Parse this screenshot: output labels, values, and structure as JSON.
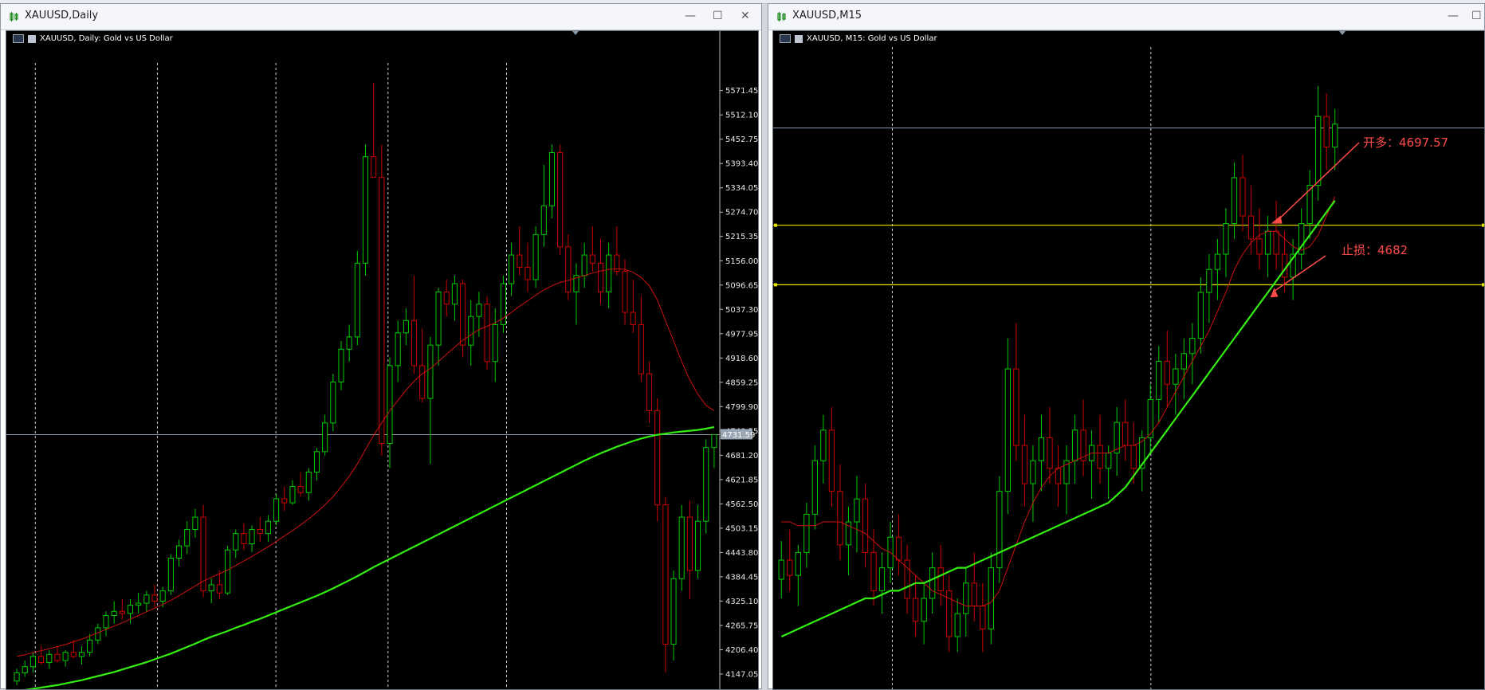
{
  "windows": [
    {
      "title": "XAUUSD,Daily",
      "chart_label": "XAUUSD, Daily:  Gold vs US Dollar"
    },
    {
      "title": "XAUUSD,M15",
      "chart_label": "XAUUSD, M15:  Gold vs US Dollar"
    }
  ],
  "window_controls": {
    "minimize": "—",
    "maximize": "☐",
    "close": "✕"
  },
  "colors": {
    "background": "#000000",
    "bull": "#00cc00",
    "bear": "#cc0000",
    "ma_fast": "#cc1111",
    "ma_slow": "#33ee11",
    "level": "#e6e600",
    "annotation": "#ff4a4a"
  },
  "annotations": {
    "entry_text": "开多：4697.57",
    "stop_text": "止损：4682"
  },
  "chart_data": [
    {
      "type": "candlestick",
      "title": "XAUUSD, Daily:  Gold vs US Dollar",
      "y_ticks": [
        "5571.45",
        "5512.10",
        "5452.75",
        "5393.40",
        "5334.05",
        "5274.70",
        "5215.35",
        "5156.00",
        "5096.65",
        "5037.30",
        "4977.95",
        "4918.60",
        "4859.25",
        "4799.90",
        "4740.55",
        "4681.20",
        "4621.85",
        "4562.50",
        "4503.15",
        "4443.80",
        "4384.45",
        "4325.10",
        "4265.75",
        "4206.40",
        "4147.05"
      ],
      "ylim": [
        4110,
        5600
      ],
      "current_price_label": "4731.59",
      "current_price": 4731.59,
      "grid": "vertical dashed separators",
      "ohlc": [
        [
          4130,
          4160,
          4120,
          4150
        ],
        [
          4150,
          4180,
          4140,
          4165
        ],
        [
          4165,
          4200,
          4150,
          4190
        ],
        [
          4190,
          4215,
          4170,
          4175
        ],
        [
          4175,
          4205,
          4160,
          4195
        ],
        [
          4195,
          4215,
          4175,
          4180
        ],
        [
          4180,
          4205,
          4165,
          4200
        ],
        [
          4200,
          4230,
          4185,
          4190
        ],
        [
          4190,
          4215,
          4170,
          4200
        ],
        [
          4200,
          4245,
          4190,
          4230
        ],
        [
          4230,
          4270,
          4220,
          4260
        ],
        [
          4260,
          4300,
          4240,
          4290
        ],
        [
          4290,
          4325,
          4270,
          4300
        ],
        [
          4300,
          4330,
          4280,
          4295
        ],
        [
          4295,
          4330,
          4270,
          4315
        ],
        [
          4315,
          4345,
          4295,
          4320
        ],
        [
          4320,
          4350,
          4300,
          4340
        ],
        [
          4340,
          4365,
          4310,
          4325
        ],
        [
          4325,
          4360,
          4310,
          4350
        ],
        [
          4350,
          4440,
          4340,
          4430
        ],
        [
          4430,
          4475,
          4410,
          4460
        ],
        [
          4460,
          4520,
          4440,
          4500
        ],
        [
          4500,
          4550,
          4480,
          4530
        ],
        [
          4530,
          4560,
          4335,
          4350
        ],
        [
          4350,
          4380,
          4320,
          4365
        ],
        [
          4365,
          4400,
          4330,
          4345
        ],
        [
          4345,
          4460,
          4340,
          4450
        ],
        [
          4450,
          4500,
          4430,
          4490
        ],
        [
          4490,
          4515,
          4450,
          4465
        ],
        [
          4465,
          4510,
          4445,
          4500
        ],
        [
          4500,
          4530,
          4470,
          4490
        ],
        [
          4490,
          4535,
          4470,
          4520
        ],
        [
          4520,
          4585,
          4510,
          4575
        ],
        [
          4575,
          4605,
          4545,
          4565
        ],
        [
          4565,
          4620,
          4560,
          4605
        ],
        [
          4605,
          4640,
          4580,
          4590
        ],
        [
          4590,
          4650,
          4570,
          4640
        ],
        [
          4640,
          4700,
          4620,
          4690
        ],
        [
          4690,
          4780,
          4680,
          4760
        ],
        [
          4760,
          4880,
          4740,
          4860
        ],
        [
          4860,
          4960,
          4840,
          4940
        ],
        [
          4940,
          5000,
          4910,
          4970
        ],
        [
          4970,
          5180,
          4950,
          5150
        ],
        [
          5150,
          5440,
          5120,
          5410
        ],
        [
          5410,
          5590,
          5360,
          5360
        ],
        [
          5360,
          5440,
          4680,
          4710
        ],
        [
          4710,
          4920,
          4650,
          4900
        ],
        [
          4900,
          5010,
          4860,
          4980
        ],
        [
          4980,
          5040,
          4950,
          5010
        ],
        [
          5010,
          5120,
          4880,
          4900
        ],
        [
          4900,
          4990,
          4810,
          4820
        ],
        [
          4820,
          4970,
          4660,
          4950
        ],
        [
          4950,
          5090,
          4900,
          5080
        ],
        [
          5080,
          5110,
          5020,
          5050
        ],
        [
          5050,
          5120,
          5010,
          5100
        ],
        [
          5100,
          5110,
          4920,
          4950
        ],
        [
          4950,
          5060,
          4900,
          5020
        ],
        [
          5020,
          5080,
          4970,
          5050
        ],
        [
          5050,
          5070,
          4890,
          4910
        ],
        [
          4910,
          5040,
          4860,
          5000
        ],
        [
          5000,
          5120,
          4980,
          5100
        ],
        [
          5100,
          5200,
          5070,
          5170
        ],
        [
          5170,
          5240,
          5120,
          5140
        ],
        [
          5140,
          5200,
          5080,
          5110
        ],
        [
          5110,
          5240,
          5090,
          5220
        ],
        [
          5220,
          5390,
          5190,
          5290
        ],
        [
          5290,
          5440,
          5260,
          5420
        ],
        [
          5420,
          5440,
          5170,
          5190
        ],
        [
          5190,
          5220,
          5060,
          5080
        ],
        [
          5080,
          5150,
          5000,
          5120
        ],
        [
          5120,
          5200,
          5090,
          5170
        ],
        [
          5170,
          5240,
          5130,
          5150
        ],
        [
          5150,
          5210,
          5050,
          5080
        ],
        [
          5080,
          5200,
          5040,
          5170
        ],
        [
          5170,
          5240,
          5120,
          5130
        ],
        [
          5130,
          5160,
          5000,
          5030
        ],
        [
          5030,
          5110,
          4980,
          5000
        ],
        [
          5000,
          5070,
          4860,
          4880
        ],
        [
          4880,
          4910,
          4760,
          4790
        ],
        [
          4790,
          4820,
          4520,
          4560
        ],
        [
          4560,
          4580,
          4150,
          4220
        ],
        [
          4220,
          4400,
          4180,
          4380
        ],
        [
          4380,
          4560,
          4350,
          4530
        ],
        [
          4530,
          4570,
          4330,
          4400
        ],
        [
          4400,
          4560,
          4380,
          4520
        ],
        [
          4520,
          4720,
          4490,
          4700
        ],
        [
          4700,
          4730,
          4650,
          4731.59
        ]
      ],
      "ma_fast": [
        4190,
        4194,
        4199,
        4204,
        4209,
        4214,
        4219,
        4226,
        4232,
        4240,
        4248,
        4256,
        4264,
        4272,
        4281,
        4290,
        4299,
        4308,
        4317,
        4327,
        4338,
        4350,
        4362,
        4374,
        4383,
        4392,
        4401,
        4412,
        4423,
        4434,
        4446,
        4458,
        4471,
        4484,
        4497,
        4511,
        4526,
        4542,
        4560,
        4580,
        4604,
        4630,
        4660,
        4695,
        4730,
        4760,
        4790,
        4815,
        4840,
        4862,
        4880,
        4893,
        4910,
        4928,
        4945,
        4962,
        4975,
        4988,
        4996,
        5005,
        5016,
        5030,
        5045,
        5058,
        5072,
        5085,
        5095,
        5103,
        5108,
        5114,
        5120,
        5126,
        5131,
        5135,
        5136,
        5135,
        5128,
        5115,
        5095,
        5060,
        5010,
        4960,
        4910,
        4865,
        4830,
        4803,
        4790
      ],
      "ma_slow": [
        4105,
        4108,
        4111,
        4114,
        4117,
        4120,
        4124,
        4128,
        4132,
        4137,
        4142,
        4147,
        4152,
        4158,
        4164,
        4170,
        4176,
        4183,
        4190,
        4197,
        4205,
        4213,
        4221,
        4230,
        4238,
        4245,
        4252,
        4260,
        4267,
        4275,
        4282,
        4290,
        4298,
        4306,
        4314,
        4322,
        4330,
        4338,
        4347,
        4356,
        4366,
        4376,
        4386,
        4397,
        4408,
        4418,
        4428,
        4438,
        4448,
        4458,
        4468,
        4478,
        4488,
        4498,
        4508,
        4518,
        4528,
        4538,
        4548,
        4558,
        4568,
        4578,
        4588,
        4598,
        4608,
        4618,
        4628,
        4638,
        4648,
        4658,
        4668,
        4677,
        4686,
        4694,
        4702,
        4709,
        4716,
        4722,
        4727,
        4731,
        4734,
        4737,
        4739,
        4741,
        4743,
        4746,
        4750
      ]
    },
    {
      "type": "candlestick",
      "title": "XAUUSD, M15:  Gold vs US Dollar",
      "ylim": [
        4580,
        4740
      ],
      "levels": [
        4697.57,
        4682
      ],
      "current_price": 4723,
      "grid": "vertical dashed separators",
      "ohlc": [
        [
          4605,
          4615,
          4600,
          4610
        ],
        [
          4610,
          4618,
          4602,
          4606
        ],
        [
          4606,
          4614,
          4598,
          4612
        ],
        [
          4612,
          4625,
          4608,
          4622
        ],
        [
          4622,
          4640,
          4618,
          4636
        ],
        [
          4636,
          4648,
          4630,
          4644
        ],
        [
          4644,
          4650,
          4624,
          4628
        ],
        [
          4628,
          4635,
          4610,
          4614
        ],
        [
          4614,
          4624,
          4606,
          4620
        ],
        [
          4620,
          4632,
          4612,
          4626
        ],
        [
          4626,
          4630,
          4608,
          4612
        ],
        [
          4612,
          4618,
          4598,
          4602
        ],
        [
          4602,
          4612,
          4596,
          4608
        ],
        [
          4608,
          4620,
          4604,
          4616
        ],
        [
          4616,
          4622,
          4606,
          4610
        ],
        [
          4610,
          4614,
          4596,
          4600
        ],
        [
          4600,
          4606,
          4590,
          4594
        ],
        [
          4594,
          4604,
          4588,
          4600
        ],
        [
          4600,
          4612,
          4596,
          4608
        ],
        [
          4608,
          4614,
          4598,
          4602
        ],
        [
          4602,
          4606,
          4586,
          4590
        ],
        [
          4590,
          4600,
          4586,
          4596
        ],
        [
          4596,
          4608,
          4590,
          4604
        ],
        [
          4604,
          4612,
          4594,
          4598
        ],
        [
          4598,
          4604,
          4586,
          4592
        ],
        [
          4592,
          4612,
          4588,
          4608
        ],
        [
          4608,
          4632,
          4604,
          4628
        ],
        [
          4628,
          4668,
          4622,
          4660
        ],
        [
          4660,
          4672,
          4636,
          4640
        ],
        [
          4640,
          4648,
          4624,
          4630
        ],
        [
          4630,
          4640,
          4620,
          4636
        ],
        [
          4636,
          4648,
          4628,
          4642
        ],
        [
          4642,
          4650,
          4630,
          4634
        ],
        [
          4634,
          4640,
          4624,
          4630
        ],
        [
          4630,
          4640,
          4622,
          4636
        ],
        [
          4636,
          4648,
          4630,
          4644
        ],
        [
          4644,
          4652,
          4632,
          4636
        ],
        [
          4636,
          4644,
          4626,
          4640
        ],
        [
          4640,
          4648,
          4630,
          4634
        ],
        [
          4634,
          4640,
          4626,
          4638
        ],
        [
          4638,
          4650,
          4632,
          4646
        ],
        [
          4646,
          4652,
          4636,
          4640
        ],
        [
          4640,
          4646,
          4630,
          4634
        ],
        [
          4634,
          4644,
          4628,
          4642
        ],
        [
          4642,
          4656,
          4638,
          4652
        ],
        [
          4652,
          4666,
          4646,
          4662
        ],
        [
          4662,
          4670,
          4650,
          4656
        ],
        [
          4656,
          4664,
          4648,
          4660
        ],
        [
          4660,
          4668,
          4652,
          4664
        ],
        [
          4664,
          4672,
          4656,
          4668
        ],
        [
          4668,
          4684,
          4664,
          4680
        ],
        [
          4680,
          4690,
          4672,
          4686
        ],
        [
          4686,
          4694,
          4678,
          4690
        ],
        [
          4690,
          4702,
          4684,
          4698
        ],
        [
          4698,
          4714,
          4694,
          4710
        ],
        [
          4710,
          4716,
          4696,
          4700
        ],
        [
          4700,
          4708,
          4690,
          4694
        ],
        [
          4694,
          4702,
          4686,
          4690
        ],
        [
          4690,
          4700,
          4684,
          4696
        ],
        [
          4696,
          4704,
          4686,
          4690
        ],
        [
          4690,
          4696,
          4680,
          4684
        ],
        [
          4684,
          4694,
          4678,
          4690
        ],
        [
          4690,
          4702,
          4686,
          4698
        ],
        [
          4698,
          4712,
          4694,
          4708
        ],
        [
          4708,
          4734,
          4704,
          4726
        ],
        [
          4726,
          4732,
          4712,
          4718
        ],
        [
          4718,
          4728,
          4712,
          4724
        ]
      ],
      "ma_fast": [
        4620,
        4620,
        4619,
        4619,
        4619,
        4620,
        4620,
        4620,
        4619,
        4618,
        4617,
        4615,
        4613,
        4612,
        4610,
        4608,
        4606,
        4604,
        4602,
        4601,
        4600,
        4599,
        4598,
        4598,
        4598,
        4599,
        4602,
        4608,
        4614,
        4620,
        4625,
        4629,
        4632,
        4634,
        4635,
        4636,
        4637,
        4638,
        4638,
        4638,
        4639,
        4640,
        4640,
        4641,
        4643,
        4646,
        4650,
        4654,
        4658,
        4662,
        4666,
        4670,
        4675,
        4680,
        4686,
        4690,
        4693,
        4695,
        4696,
        4696,
        4694,
        4692,
        4691,
        4692,
        4695,
        4700,
        4705
      ],
      "ma_slow": [
        4590,
        4591,
        4592,
        4593,
        4594,
        4595,
        4596,
        4597,
        4598,
        4599,
        4600,
        4600,
        4601,
        4602,
        4602,
        4603,
        4604,
        4604,
        4605,
        4606,
        4607,
        4608,
        4608,
        4609,
        4610,
        4611,
        4612,
        4613,
        4614,
        4615,
        4616,
        4617,
        4618,
        4619,
        4620,
        4621,
        4622,
        4623,
        4624,
        4625,
        4627,
        4629,
        4632,
        4635,
        4638,
        4641,
        4644,
        4647,
        4650,
        4653,
        4656,
        4659,
        4662,
        4665,
        4668,
        4671,
        4674,
        4677,
        4680,
        4683,
        4686,
        4689,
        4692,
        4695,
        4698,
        4701,
        4704
      ]
    }
  ]
}
